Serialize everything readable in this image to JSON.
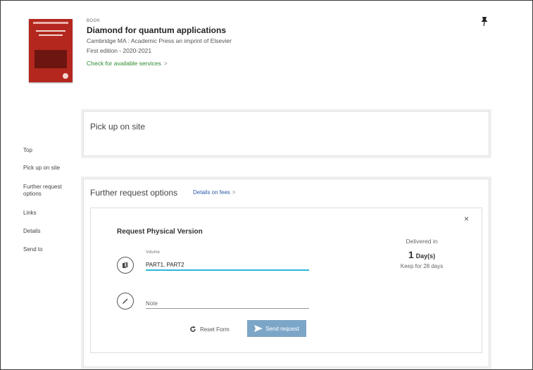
{
  "record": {
    "type": "BOOK",
    "title": "Diamond for quantum applications",
    "publisher": "Cambridge MA : Academic Press an imprint of Elsevier",
    "edition": "First edition - 2020-2021",
    "services_link": "Check for available services",
    "services_chevron": ">",
    "cover_color": "#b3271e"
  },
  "nav": {
    "items": [
      "Top",
      "Pick up on site",
      "Further request options",
      "Links",
      "Details",
      "Send to"
    ]
  },
  "pickup": {
    "title": "Pick up on site"
  },
  "further": {
    "title": "Further request options",
    "fees_link": "Details on fees",
    "fees_chevron": ">"
  },
  "form": {
    "close": "×",
    "title": "Request Physical Version",
    "volume_label": "Volume",
    "volume_value": "PART1, PART2",
    "note_placeholder": "Note",
    "delivered_label": "Delivered in",
    "delivered_number": "1",
    "delivered_unit": "Day(s)",
    "keep_text": "Keep for 28 days",
    "reset_label": "Reset Form",
    "send_label": "Send request",
    "send_color": "#7ca6c8",
    "focus_color": "#29b8d8"
  },
  "icons": {
    "pin": "pin-icon",
    "volume": "book-stack-icon",
    "note": "pencil-icon",
    "reset": "reset-icon",
    "send": "paper-plane-icon"
  }
}
